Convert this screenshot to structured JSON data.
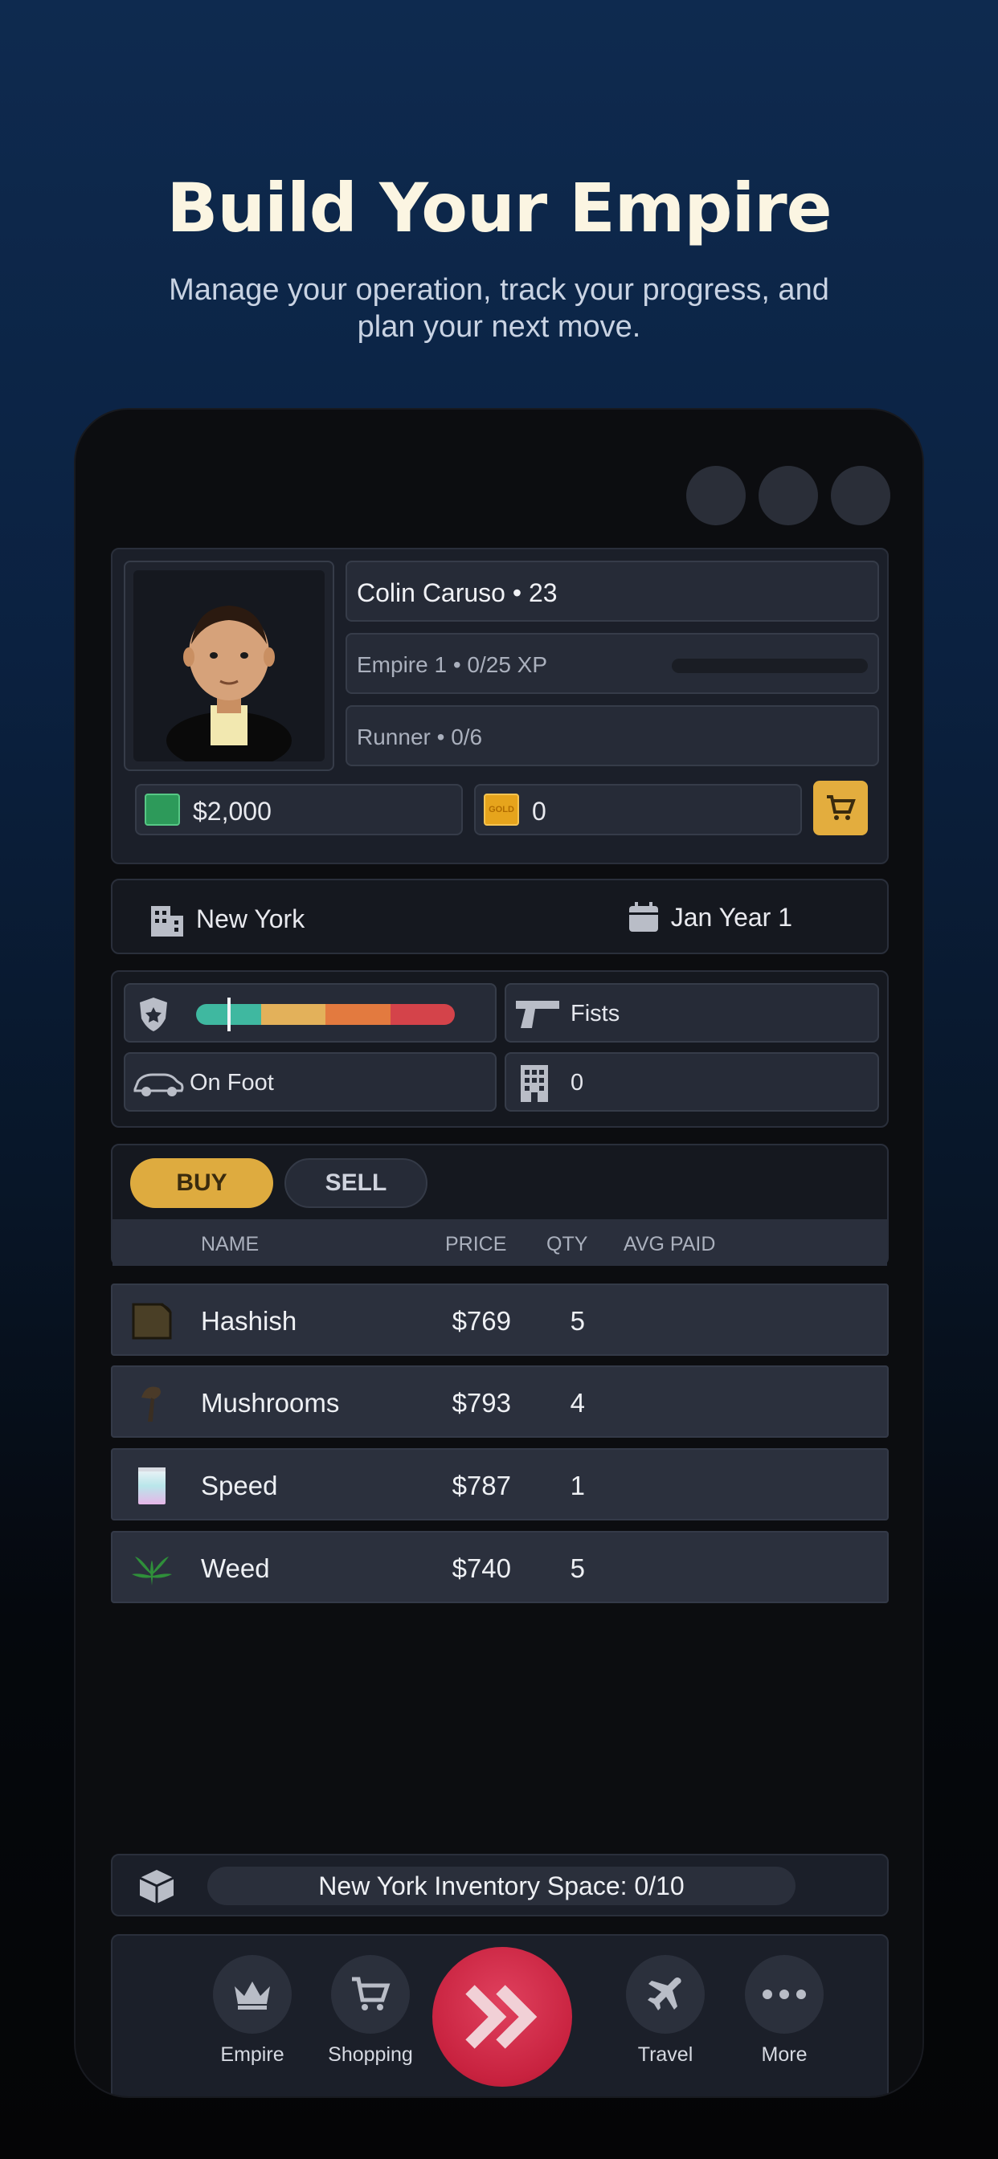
{
  "promo": {
    "title": "Build Your Empire",
    "subtitle": "Manage your operation, track your progress, and plan your next move."
  },
  "player": {
    "name_age": "Colin Caruso • 23",
    "empire_xp": "Empire 1 • 0/25 XP",
    "xp_progress": 0,
    "rank": "Runner • 0/6",
    "cash": "$2,000",
    "gold": "0",
    "gold_icon_text": "GOLD"
  },
  "location": {
    "city": "New York",
    "date": "Jan Year 1"
  },
  "stats": {
    "heat_colors": [
      "#3fb8a0",
      "#e3b15a",
      "#e37a3f",
      "#d4434a"
    ],
    "heat_level": 0.12,
    "weapon": "Fists",
    "vehicle": "On Foot",
    "properties": "0"
  },
  "market": {
    "tab_buy": "BUY",
    "tab_sell": "SELL",
    "columns": {
      "name": "NAME",
      "price": "PRICE",
      "qty": "QTY",
      "avg_paid": "AVG PAID"
    },
    "items": [
      {
        "name": "Hashish",
        "price": "$769",
        "qty": "5",
        "icon": "hashish-icon"
      },
      {
        "name": "Mushrooms",
        "price": "$793",
        "qty": "4",
        "icon": "mushroom-icon"
      },
      {
        "name": "Speed",
        "price": "$787",
        "qty": "1",
        "icon": "speed-bag-icon"
      },
      {
        "name": "Weed",
        "price": "$740",
        "qty": "5",
        "icon": "weed-leaf-icon"
      }
    ]
  },
  "inventory": {
    "label": "New York Inventory Space: 0/10"
  },
  "nav": {
    "empire": "Empire",
    "shopping": "Shopping",
    "travel": "Travel",
    "more": "More"
  },
  "colors": {
    "accent_gold": "#deab3f",
    "go_red": "#c8223f"
  }
}
